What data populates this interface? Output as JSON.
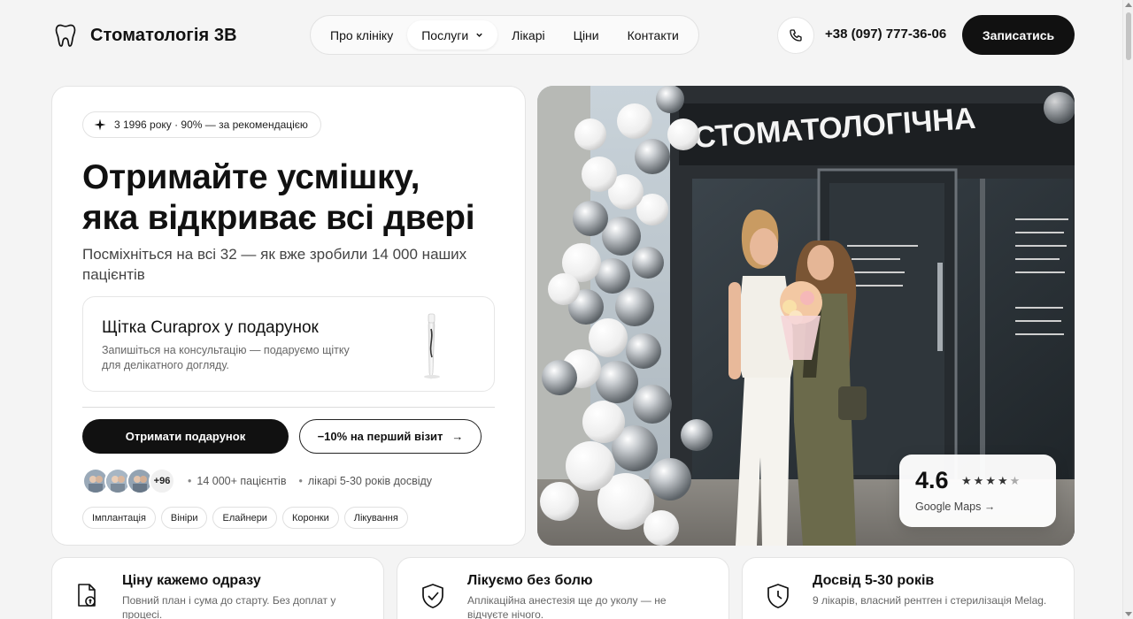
{
  "header": {
    "brand": "Стоматологія 3В",
    "nav": [
      "Про клініку",
      "Послуги",
      "Лікарі",
      "Ціни",
      "Контакти"
    ],
    "phone": "+38 (097) 777-36-06",
    "cta": "Записатись"
  },
  "hero": {
    "badge": "3 1996 року · 90% — за рекомендацією",
    "title_line1": "Отримайте усмішку,",
    "title_line2": "яка відкриває всі двері",
    "subtitle": "Посміхніться на всі 32 — як вже зробили 14 000 наших пацієнтів",
    "gift_title": "Щітка Curaprox у подарунок",
    "gift_text": "Запишіться на консультацію — подаруємо щітку для делікатного догляду.",
    "primary_button": "Отримати подарунок",
    "secondary_button": "−10% на перший візит",
    "secondary_arrow": "→",
    "avatars_more": "+96",
    "proof_patients": "14 000+ пацієнтів",
    "proof_doctors": "лікарі 5-30 років досвіду",
    "tags": [
      "Імплантація",
      "Вініри",
      "Елайнери",
      "Коронки",
      "Лікування"
    ]
  },
  "photo": {
    "sign_text": "СТОМАТОЛОГІЧНА",
    "rating": "4.6",
    "stars_filled": 4,
    "stars_total": 5,
    "rating_link": "Google Maps →"
  },
  "features": [
    {
      "icon": "price-document-icon",
      "title": "Ціну кажемо одразу",
      "text": "Повний план і сума до старту. Без доплат у процесі."
    },
    {
      "icon": "shield-check-icon",
      "title": "Лікуємо без болю",
      "text": "Аплікаційна анестезія ще до уколу — не відчуєте нічого."
    },
    {
      "icon": "clock-shield-icon",
      "title": "Досвід 5-30 років",
      "text": "9 лікарів, власний рентген і стерилізація Melag."
    }
  ],
  "colors": {
    "accent": "#111111",
    "background": "#f4f4f4",
    "card": "#ffffff"
  }
}
